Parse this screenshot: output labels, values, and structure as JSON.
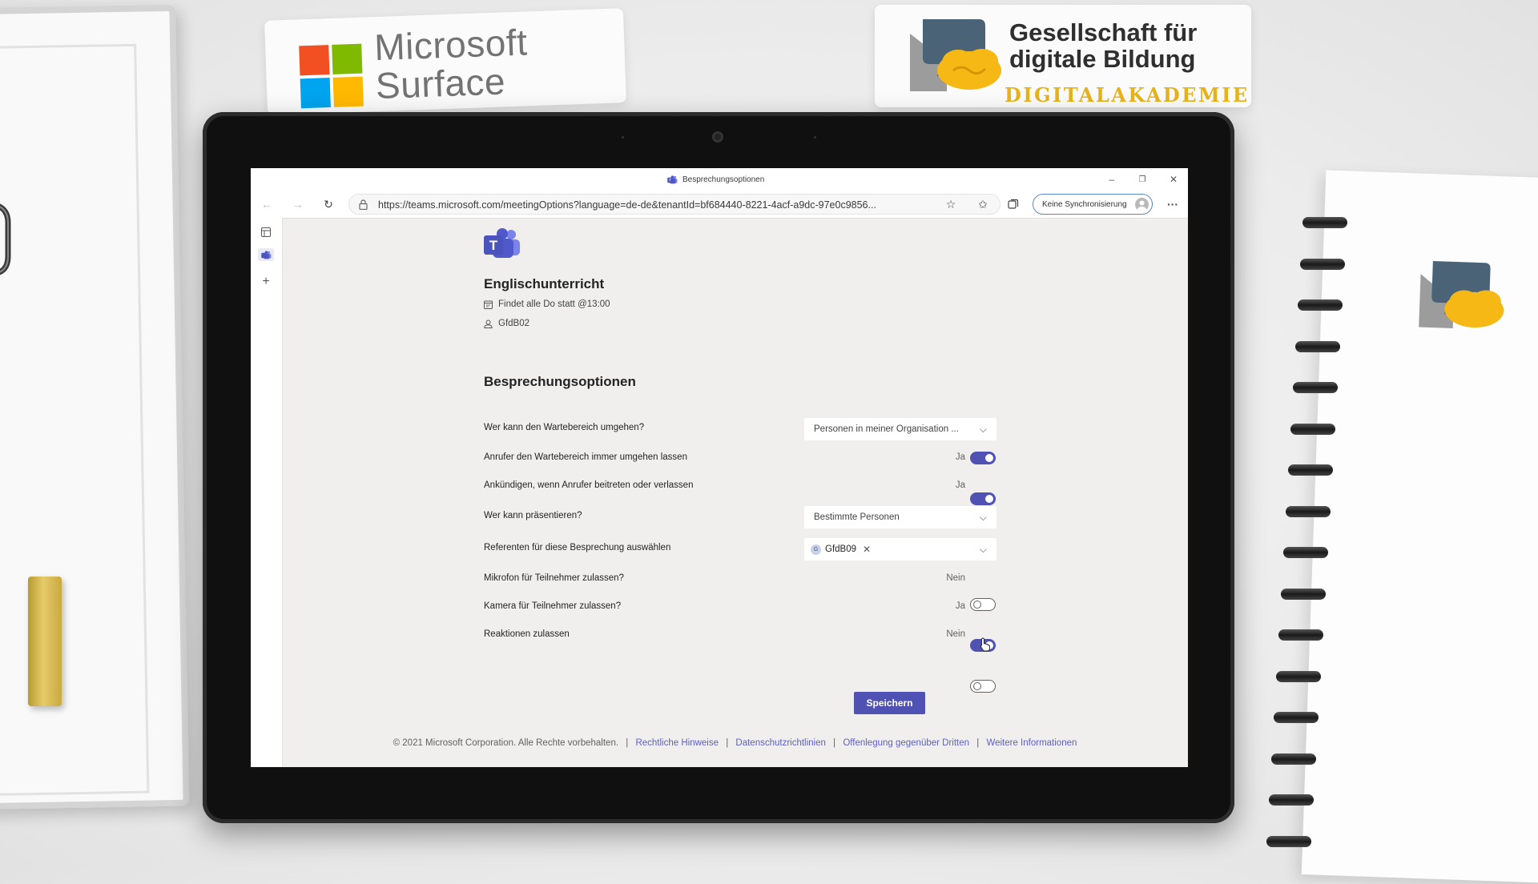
{
  "scene": {
    "microsoft_sticker": {
      "line1": "Microsoft",
      "line2": "Surface"
    },
    "gfdb_sticker": {
      "line1": "Gesellschaft für",
      "line2": "digitale Bildung",
      "subtitle": "DIGITALAKADEMIE"
    }
  },
  "browser": {
    "tab_title": "Besprechungsoptionen",
    "url": "https://teams.microsoft.com/meetingOptions?language=de-de&tenantId=bf684440-8221-4acf-a9dc-97e0c9856...",
    "sync_button": "Keine Synchronisierung",
    "window_controls": {
      "minimize": "–",
      "restore": "❐",
      "close": "✕"
    }
  },
  "meeting": {
    "title": "Englischunterricht",
    "schedule": "Findet alle Do statt @13:00",
    "organizer": "GfdB02"
  },
  "options": {
    "heading": "Besprechungsoptionen",
    "lobby_bypass": {
      "label": "Wer kann den Wartebereich umgehen?",
      "value": "Personen in meiner Organisation ..."
    },
    "callers_bypass": {
      "label": "Anrufer den Wartebereich immer umgehen lassen",
      "state": "Ja",
      "on": true
    },
    "announce": {
      "label": "Ankündigen, wenn Anrufer beitreten oder verlassen",
      "state": "Ja",
      "on": true
    },
    "presenters": {
      "label": "Wer kann präsentieren?",
      "value": "Bestimmte Personen"
    },
    "select_presenters": {
      "label": "Referenten für diese Besprechung auswählen",
      "chip": "GfdB09",
      "chip_initial": "G"
    },
    "mic": {
      "label": "Mikrofon für Teilnehmer zulassen?",
      "state": "Nein",
      "on": false
    },
    "camera": {
      "label": "Kamera für Teilnehmer zulassen?",
      "state": "Ja",
      "on": true
    },
    "reactions": {
      "label": "Reaktionen zulassen",
      "state": "Nein",
      "on": false
    },
    "save_label": "Speichern"
  },
  "footer": {
    "copyright": "© 2021 Microsoft Corporation. Alle Rechte vorbehalten.",
    "links": [
      "Rechtliche Hinweise",
      "Datenschutzrichtlinien",
      "Offenlegung gegenüber Dritten",
      "Weitere Informationen"
    ],
    "separator": "|"
  },
  "colors": {
    "accent": "#4f52b2",
    "link": "#5b5fc7",
    "page_background": "#f0efee",
    "gfdb_gold": "#e7b31a"
  },
  "icons": [
    "back-arrow-icon",
    "forward-arrow-icon",
    "refresh-icon",
    "lock-icon",
    "favorite-add-icon",
    "favorites-icon",
    "collections-icon",
    "more-icon",
    "teams-icon",
    "calendar-icon",
    "person-icon",
    "chevron-down-icon",
    "close-icon",
    "plus-icon"
  ]
}
